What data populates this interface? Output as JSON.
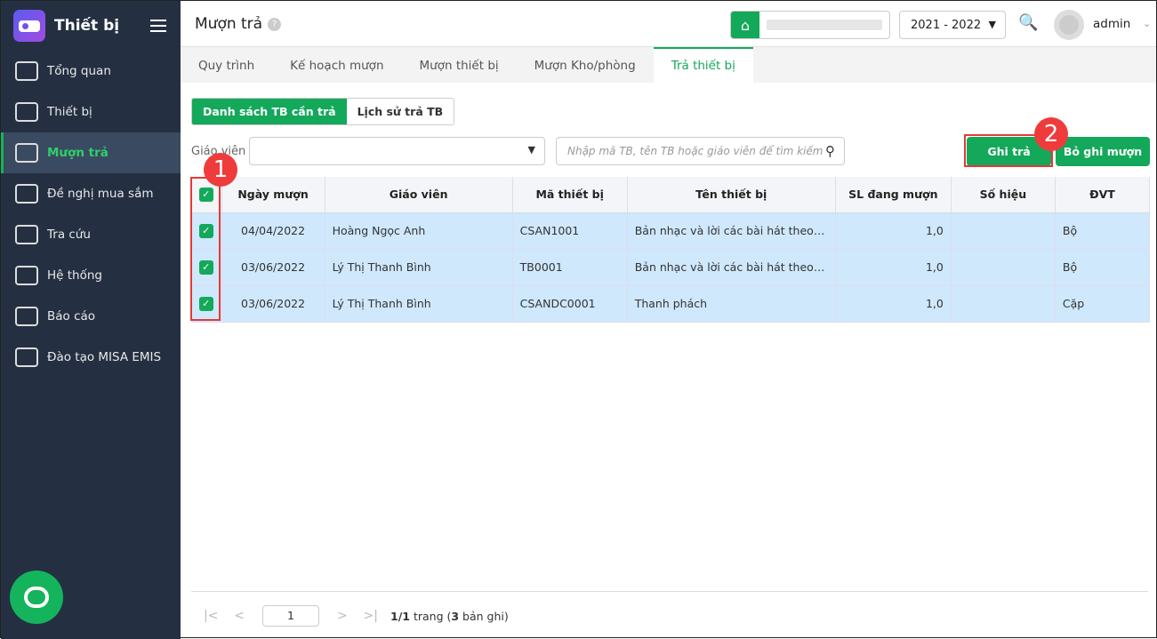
{
  "sidebar": {
    "title": "Thiết bị",
    "items": [
      {
        "label": "Tổng quan",
        "icon": "chart-icon"
      },
      {
        "label": "Thiết bị",
        "icon": "monitor-icon"
      },
      {
        "label": "Mượn trả",
        "icon": "cart-icon",
        "active": true
      },
      {
        "label": "Đề nghị mua sắm",
        "icon": "projector-icon"
      },
      {
        "label": "Tra cứu",
        "icon": "search-icon"
      },
      {
        "label": "Hệ thống",
        "icon": "gear-icon"
      },
      {
        "label": "Báo cáo",
        "icon": "pie-icon"
      },
      {
        "label": "Đào tạo MISA EMIS",
        "icon": "box-icon"
      }
    ]
  },
  "header": {
    "title": "Mượn trả",
    "help": "?",
    "year": "2021 - 2022",
    "user": "admin"
  },
  "tabs": [
    "Quy trình",
    "Kế hoạch mượn",
    "Mượn thiết bị",
    "Mượn Kho/phòng",
    "Trả thiết bị"
  ],
  "segments": [
    "Danh sách TB cần trả",
    "Lịch sử trả TB"
  ],
  "filter": {
    "teacher_label": "Giáo viên",
    "search_placeholder": "Nhập mã TB, tên TB hoặc giáo viên để tìm kiếm"
  },
  "buttons": {
    "return": "Ghi trả",
    "cancel": "Bỏ ghi mượn"
  },
  "table": {
    "headers": [
      "Ngày mượn",
      "Giáo viên",
      "Mã thiết bị",
      "Tên thiết bị",
      "SL đang mượn",
      "Số hiệu",
      "ĐVT"
    ],
    "rows": [
      [
        "04/04/2022",
        "Hoàng Ngọc Anh",
        "CSAN1001",
        "Bản nhạc và lời các bài hát theo S...",
        "1,0",
        "",
        "Bộ"
      ],
      [
        "03/06/2022",
        "Lý Thị Thanh Bình",
        "TB0001",
        "Bản nhạc và lời các bài hát theo S...",
        "1,0",
        "",
        "Bộ"
      ],
      [
        "03/06/2022",
        "Lý Thị Thanh Bình",
        "CSANDC0001",
        "Thanh phách",
        "1,0",
        "",
        "Cặp"
      ]
    ]
  },
  "pager": {
    "page": "1",
    "pages": "1/1",
    "records": "3",
    "trang": " trang (",
    "ban_ghi": " bản ghi)"
  },
  "annotations": [
    "1",
    "2"
  ]
}
